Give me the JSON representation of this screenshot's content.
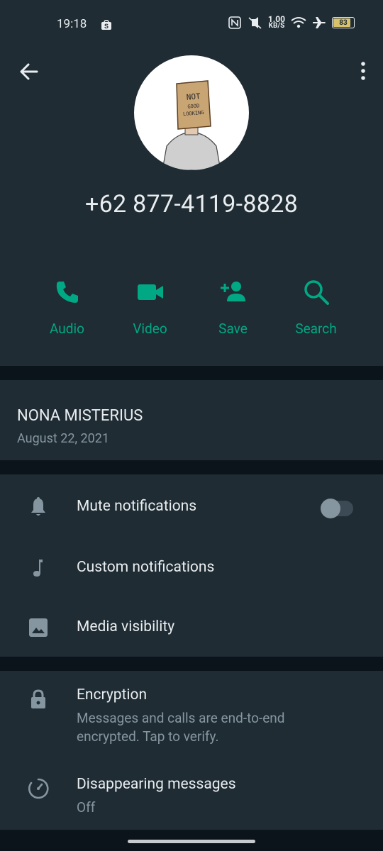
{
  "statusbar": {
    "time": "19:18",
    "speed_value": "1.00",
    "speed_unit": "KB/S",
    "battery": "83",
    "icons": [
      "shop-icon",
      "nfc-icon",
      "mute-icon",
      "wifi-icon",
      "airplane-icon",
      "battery-icon"
    ]
  },
  "header": {
    "back_icon": "arrow-left-icon",
    "menu_icon": "more-vertical-icon",
    "avatar_text": [
      "NOT",
      "GOOD",
      "LOOKING"
    ],
    "phone": "+62 877-4119-8828"
  },
  "actions": [
    {
      "label": "Audio",
      "icon": "phone-icon"
    },
    {
      "label": "Video",
      "icon": "video-icon"
    },
    {
      "label": "Save",
      "icon": "add-person-icon"
    },
    {
      "label": "Search",
      "icon": "search-icon"
    }
  ],
  "about": {
    "name": "NONA MISTERIUS",
    "date": "August 22, 2021"
  },
  "settings": {
    "mute": "Mute notifications",
    "mute_enabled": false,
    "custom": "Custom notifications",
    "media": "Media visibility"
  },
  "privacy": {
    "encryption_title": "Encryption",
    "encryption_sub": "Messages and calls are end-to-end encrypted. Tap to verify.",
    "disappearing_title": "Disappearing messages",
    "disappearing_sub": "Off"
  },
  "colors": {
    "accent": "#00a884",
    "panel": "#1f2c34",
    "background": "#0b141a",
    "secondary_text": "#8696a0"
  }
}
